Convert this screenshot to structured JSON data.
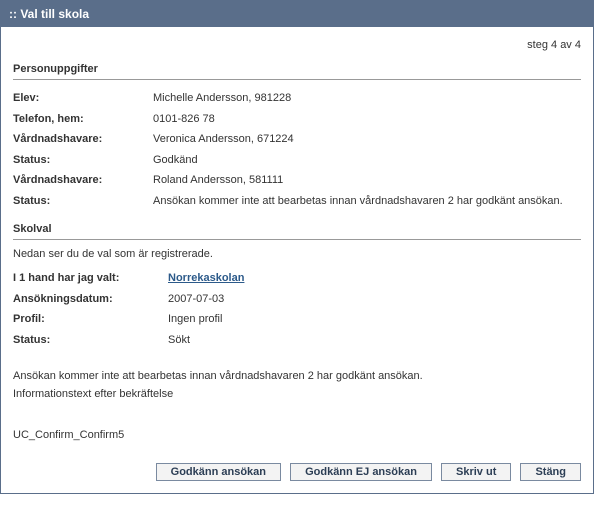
{
  "titlebar": ":: Val till skola",
  "step": "steg 4 av 4",
  "person": {
    "heading": "Personuppgifter",
    "rows": [
      {
        "label": "Elev:",
        "value": "Michelle Andersson, 981228"
      },
      {
        "label": "Telefon, hem:",
        "value": "0101-826 78"
      },
      {
        "label": "Vårdnadshavare:",
        "value": "Veronica Andersson, 671224"
      },
      {
        "label": "Status:",
        "value": "Godkänd"
      },
      {
        "label": "Vårdnadshavare:",
        "value": "Roland Andersson, 581111"
      },
      {
        "label": "Status:",
        "value": "Ansökan kommer inte att bearbetas innan vårdnadshavaren 2 har godkänt ansökan."
      }
    ]
  },
  "choice": {
    "heading": "Skolval",
    "intro": "Nedan ser du de val som är registrerade.",
    "rows": [
      {
        "label": "I 1 hand har jag valt:",
        "value": "Norrekaskolan",
        "link": true
      },
      {
        "label": "Ansökningsdatum:",
        "value": "2007-07-03"
      },
      {
        "label": "Profil:",
        "value": "Ingen profil"
      },
      {
        "label": "Status:",
        "value": "Sökt"
      }
    ]
  },
  "notes": {
    "line1": "Ansökan kommer inte att bearbetas innan vårdnadshavaren 2 har godkänt ansökan.",
    "line2": "Informationstext efter bekräftelse"
  },
  "footer_code": "UC_Confirm_Confirm5",
  "buttons": {
    "approve": "Godkänn ansökan",
    "reject": "Godkänn EJ ansökan",
    "print": "Skriv ut",
    "close": "Stäng"
  }
}
